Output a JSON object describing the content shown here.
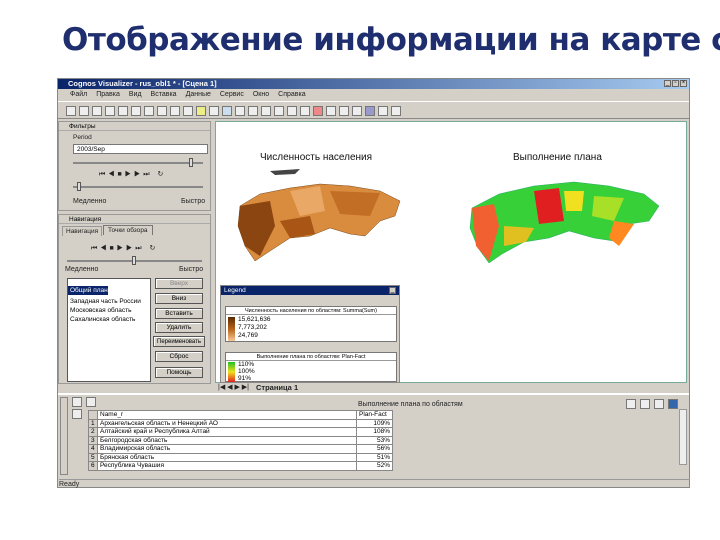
{
  "slide": {
    "title": "Отображение информации на карте с"
  },
  "window": {
    "title": "Cognos Visualizer - rus_obl1 * - [Сцена 1]"
  },
  "menu": [
    "Файл",
    "Правка",
    "Вид",
    "Вставка",
    "Данные",
    "Сервис",
    "Окно",
    "Справка"
  ],
  "filter_panel": {
    "title": "Фильтры",
    "filter_name": "Period",
    "filter_value": "2003/Sep",
    "slow": "Медленно",
    "fast": "Быстро"
  },
  "nav_panel": {
    "title": "Навигация",
    "tabs": [
      "Навигация",
      "Точки обзора"
    ],
    "slow": "Медленно",
    "fast": "Быстро",
    "viewpoints": [
      "Общий план",
      "Западная часть России",
      "Московская область",
      "Сахалинская область"
    ],
    "buttons": [
      "Вверх",
      "Вниз",
      "Вставить",
      "Удалить",
      "Переименовать",
      "Сброс",
      "Помощь"
    ]
  },
  "maps": [
    {
      "title": "Численность населения"
    },
    {
      "title": "Выполнение плана"
    }
  ],
  "legend": {
    "title": "Legend",
    "population": {
      "caption": "Численность населения по областям: Summa(Sum)",
      "values": [
        "15,621,636",
        "7,773,202",
        "24,769"
      ],
      "colors": [
        "#5a2a00",
        "#b8621a",
        "#f7c995"
      ]
    },
    "plan": {
      "caption": "Выполнение плана по областям: Plan-Fact",
      "values": [
        "110%",
        "100%",
        "91%"
      ],
      "colors": [
        "#22c022",
        "#f0e020",
        "#e02020"
      ]
    }
  },
  "page_tab": "Страница 1",
  "bottom": {
    "view_title": "Выполнение плана по областям",
    "columns": [
      "Name_r",
      "Plan-Fact"
    ],
    "rows": [
      [
        "1",
        "Архангельская область и Ненецкий АО",
        "109%"
      ],
      [
        "2",
        "Алтайский край и Республика Алтай",
        "108%"
      ],
      [
        "3",
        "Белгородская область",
        "53%"
      ],
      [
        "4",
        "Владимирская область",
        "56%"
      ],
      [
        "5",
        "Брянская область",
        "51%"
      ],
      [
        "6",
        "Республика Чувашия",
        "52%"
      ]
    ]
  },
  "status": "Ready"
}
